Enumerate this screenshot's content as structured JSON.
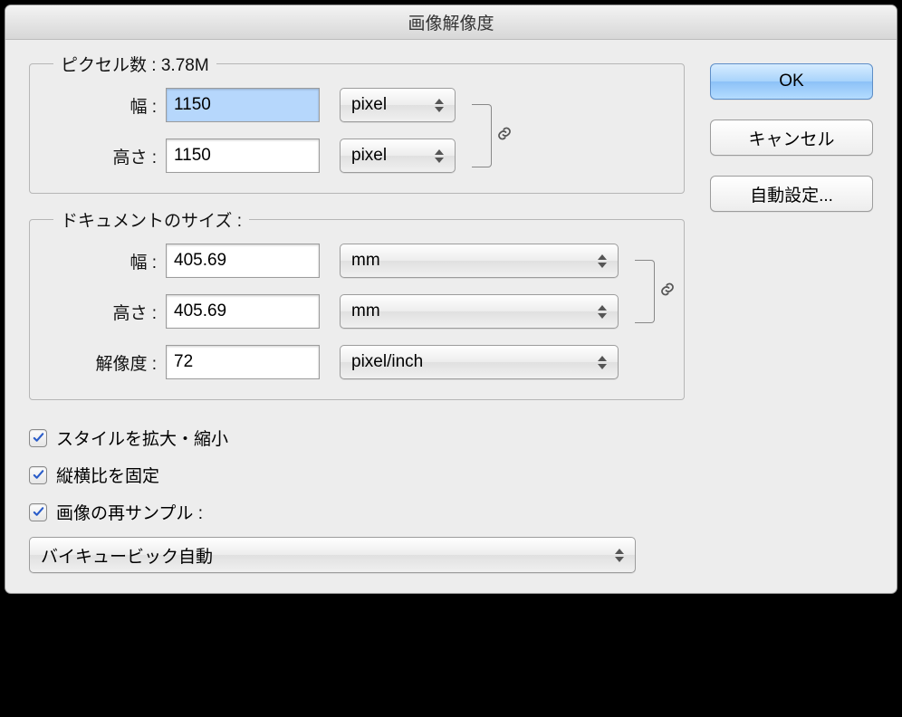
{
  "title": "画像解像度",
  "pixel_section": {
    "legend_prefix": "ピクセル数 : ",
    "size": "3.78M",
    "width_label": "幅 :",
    "width_value": "1150",
    "width_unit": "pixel",
    "height_label": "高さ :",
    "height_value": "1150",
    "height_unit": "pixel"
  },
  "doc_section": {
    "legend": "ドキュメントのサイズ :",
    "width_label": "幅 :",
    "width_value": "405.69",
    "width_unit": "mm",
    "height_label": "高さ :",
    "height_value": "405.69",
    "height_unit": "mm",
    "res_label": "解像度 :",
    "res_value": "72",
    "res_unit": "pixel/inch"
  },
  "checks": {
    "scale_styles": "スタイルを拡大・縮小",
    "constrain": "縦横比を固定",
    "resample": "画像の再サンプル :"
  },
  "resample_method": "バイキュービック自動",
  "buttons": {
    "ok": "OK",
    "cancel": "キャンセル",
    "auto": "自動設定..."
  }
}
